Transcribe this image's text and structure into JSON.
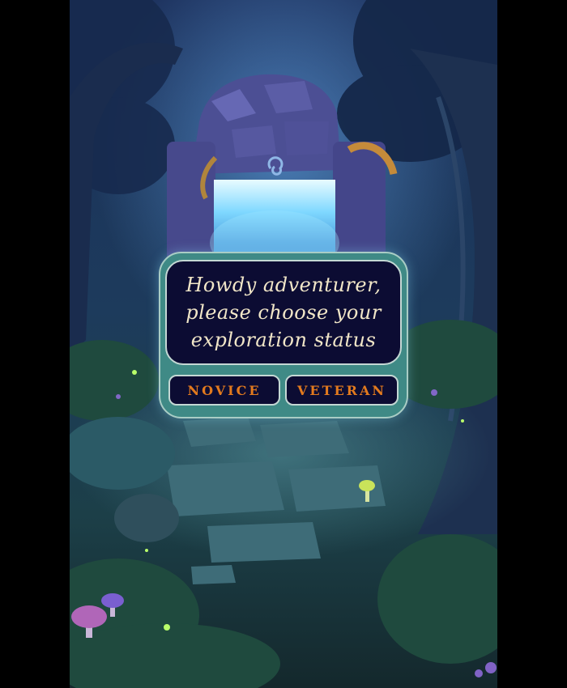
{
  "dialog": {
    "message_lines": "Howdy adventurer,\nplease choose your\nexploration status",
    "buttons": {
      "novice_label": "NOVICE",
      "veteran_label": "VETERAN"
    }
  },
  "colors": {
    "dialog_frame": "#3f8a86",
    "message_background": "#0c0c33",
    "message_text": "#f1e6c8",
    "button_text": "#e27a1e",
    "page_background": "#000000"
  },
  "icons": [
    "stone-portal-icon",
    "swirl-rune-icon",
    "tree-icon",
    "mushroom-icon",
    "firefly-icon",
    "stone-path-icon"
  ]
}
